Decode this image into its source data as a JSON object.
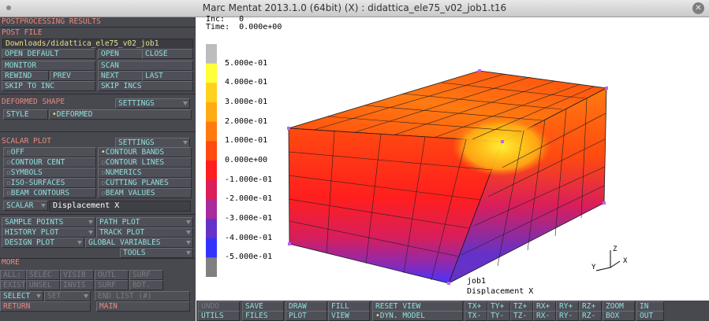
{
  "window": {
    "title": "Marc Mentat 2013.1.0 (64bit) (X) : didattica_ele75_v02_job1.t16"
  },
  "panel": {
    "header": "POSTPROCESSING RESULTS",
    "post_file": {
      "label": "POST FILE",
      "path": "Downloads/didattica_ele75_v02_job1",
      "open_default": "OPEN DEFAULT",
      "open": "OPEN",
      "close": "CLOSE",
      "monitor": "MONITOR",
      "scan": "SCAN",
      "rewind": "REWIND",
      "prev": "PREV",
      "next": "NEXT",
      "last": "LAST",
      "skip_to_inc": "SKIP TO INC",
      "skip_incs": "SKIP INCS"
    },
    "deformed": {
      "label": "DEFORMED SHAPE",
      "settings": "SETTINGS",
      "style": "STYLE",
      "style_value": "DEFORMED"
    },
    "scalar": {
      "label": "SCALAR PLOT",
      "settings": "SETTINGS",
      "off": "OFF",
      "contour_bands": "CONTOUR BANDS",
      "contour_cent": "CONTOUR CENT",
      "contour_lines": "CONTOUR LINES",
      "symbols": "SYMBOLS",
      "numerics": "NUMERICS",
      "iso_surfaces": "ISO-SURFACES",
      "cutting_planes": "CUTTING PLANES",
      "beam_contours": "BEAM CONTOURS",
      "beam_values": "BEAM VALUES",
      "scalar_btn": "SCALAR",
      "scalar_value": "Displacement X"
    },
    "plots": {
      "sample_points": "SAMPLE POINTS",
      "path_plot": "PATH PLOT",
      "history_plot": "HISTORY PLOT",
      "track_plot": "TRACK PLOT",
      "design_plot": "DESIGN PLOT",
      "global_variables": "GLOBAL VARIABLES",
      "tools": "TOOLS"
    },
    "more": {
      "label": "MORE",
      "all": "ALL:",
      "selec": "SELEC",
      "visib": "VISIB",
      "outl": "OUTL",
      "surf": "SURF",
      "exist": "EXIST.",
      "unsel": "UNSEL",
      "invis": "INVIS",
      "surfb": "SURF",
      "bdt": "BDT.",
      "select": "SELECT",
      "set": "SET",
      "end_list": "END LIST (#)",
      "return": "RETURN",
      "main": "MAIN"
    }
  },
  "viewport": {
    "inc_label": "Inc:",
    "inc_value": "0",
    "time_label": "Time:",
    "time_value": "0.000e+00",
    "job": "job1",
    "quantity": "Displacement X",
    "legend_labels": [
      "5.000e-01",
      "4.000e-01",
      "3.000e-01",
      "2.000e-01",
      "1.000e-01",
      "0.000e+00",
      "-1.000e-01",
      "-2.000e-01",
      "-3.000e-01",
      "-4.000e-01",
      "-5.000e-01"
    ],
    "legend_colors": [
      "#bdbdbd",
      "#ffff3a",
      "#ffd21e",
      "#ffac14",
      "#ff7a10",
      "#ff4a10",
      "#ff1e1e",
      "#d91e5a",
      "#a82a9c",
      "#6432c8",
      "#3232ff",
      "#808080"
    ],
    "triad": {
      "z": "Z",
      "y": "Y",
      "x": "X"
    }
  },
  "toolbar": {
    "undo": "UNDO",
    "utils": "UTILS",
    "save": "SAVE",
    "files": "FILES",
    "draw": "DRAW",
    "plot": "PLOT",
    "fill": "FILL",
    "view": "VIEW",
    "reset_view": "RESET VIEW",
    "dyn_model": "DYN. MODEL",
    "tx_plus": "TX+",
    "tx_minus": "TX-",
    "ty_plus": "TY+",
    "ty_minus": "TY-",
    "tz_plus": "TZ+",
    "tz_minus": "TZ-",
    "rx_plus": "RX+",
    "rx_minus": "RX-",
    "ry_plus": "RY+",
    "ry_minus": "RY-",
    "rz_plus": "RZ+",
    "rz_minus": "RZ-",
    "zoom": "ZOOM",
    "box": "BOX",
    "in": "IN",
    "out": "OUT"
  }
}
